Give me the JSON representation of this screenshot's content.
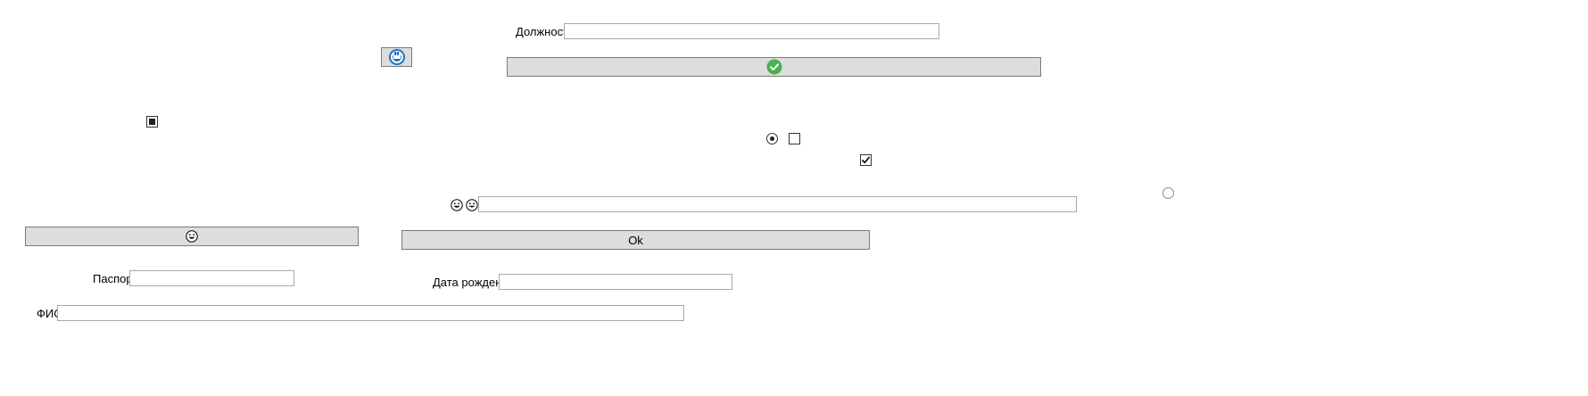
{
  "form": {
    "position_label": "Должность",
    "position_value": "",
    "passport_label": "Паспорт",
    "passport_value": "",
    "birthdate_label": "Дата рождения",
    "birthdate_value": "",
    "fullname_label": "ФИО",
    "fullname_value": "",
    "emoji_field_value": ""
  },
  "buttons": {
    "ok_label": "Ok",
    "confirm_icon": "green-check-icon",
    "refresh_icon": "refresh-icon",
    "emoji_button_icon": "grinning-face-icon"
  },
  "controls": {
    "checkbox_square_filled": "indeterminate",
    "checkbox_empty": "unchecked",
    "checkbox_checked": "checked",
    "radio_selected": "selected",
    "radio_empty": "unselected"
  },
  "colors": {
    "button_bg": "#dddddd",
    "check_green": "#4caf50",
    "refresh_blue": "#1e6fc8"
  }
}
